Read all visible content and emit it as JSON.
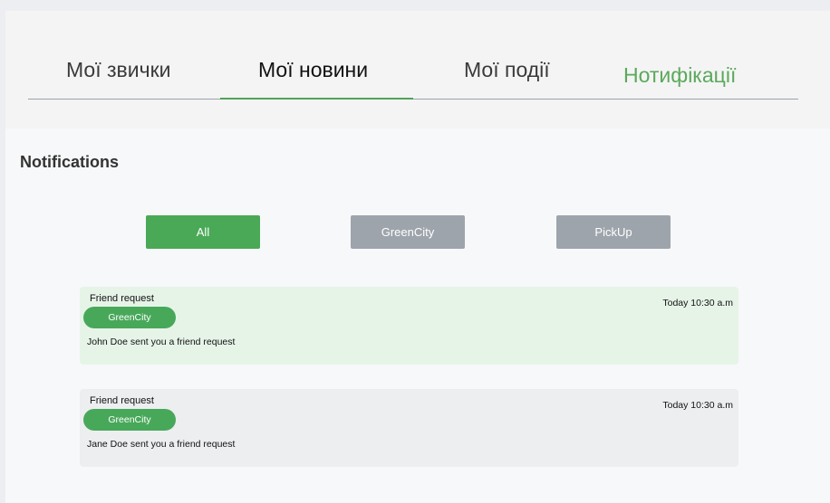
{
  "tabs": [
    {
      "label": "Мої звички",
      "state": "inactive"
    },
    {
      "label": "Мої новини",
      "state": "active"
    },
    {
      "label": "Мої події",
      "state": "inactive"
    },
    {
      "label": "Нотифікації",
      "state": "highlight"
    }
  ],
  "section": {
    "title": "Notifications"
  },
  "filters": [
    {
      "label": "All",
      "state": "active"
    },
    {
      "label": "GreenCity",
      "state": "inactive"
    },
    {
      "label": "PickUp",
      "state": "inactive"
    }
  ],
  "notifications": [
    {
      "title": "Friend request",
      "badge": "GreenCity",
      "message": "John Doe sent you a friend request",
      "time": "Today 10:30 a.m"
    },
    {
      "title": "Friend request",
      "badge": "GreenCity",
      "message": "Jane Doe sent you a friend request",
      "time": "Today 10:30 a.m"
    }
  ],
  "colors": {
    "accent_green": "#4aa957",
    "inactive_gray": "#9ea4ab",
    "card_green_bg": "#e6f4e8",
    "card_gray_bg": "#eceef0"
  }
}
